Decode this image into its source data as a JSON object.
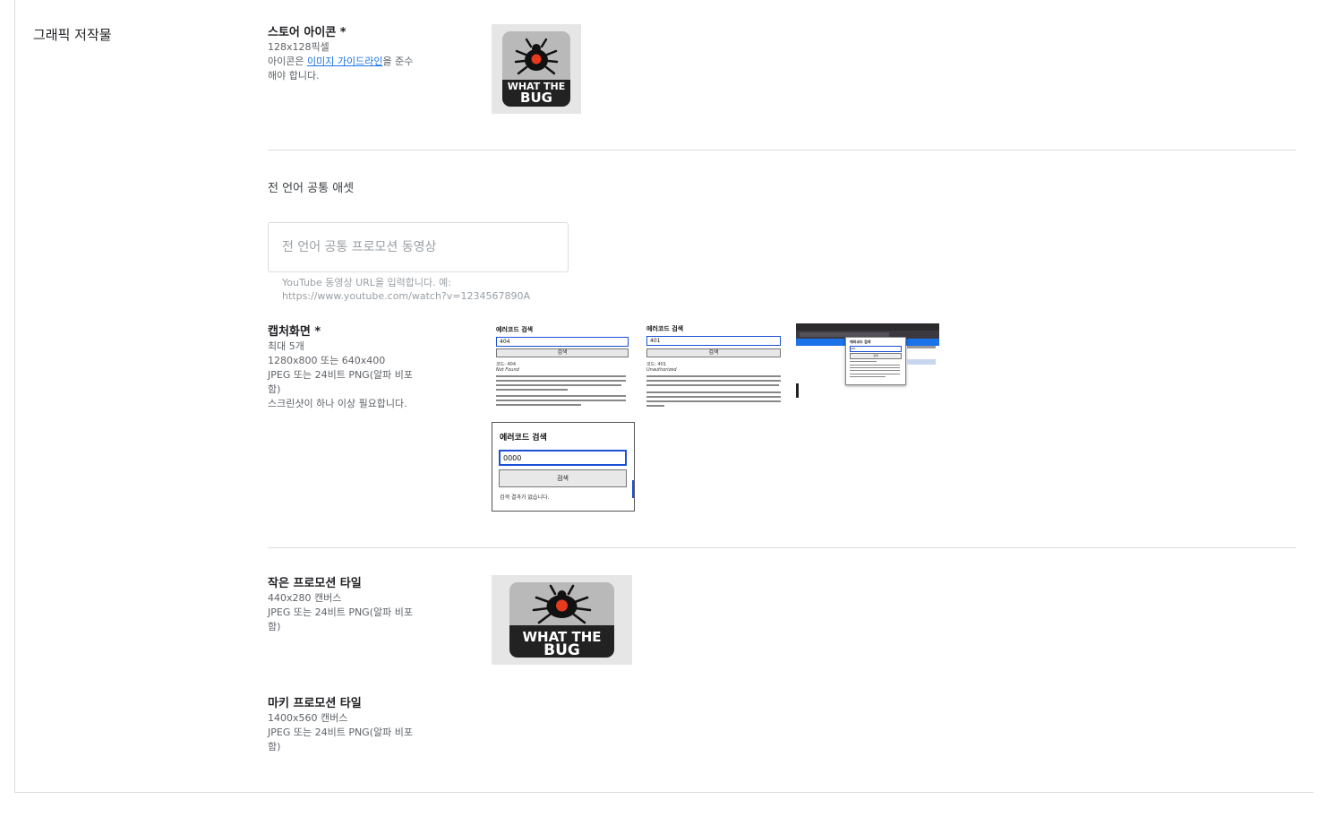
{
  "section": {
    "title": "그래픽 저작물"
  },
  "store_icon": {
    "title": "스토어 아이콘 *",
    "size": "128x128픽셀",
    "guide_prefix": "아이콘은 ",
    "guide_link": "이미지 가이드라인",
    "guide_suffix": "을 준수",
    "guide_line2": "해야 합니다.",
    "logo": {
      "line1": "WHAT THE",
      "line2": "BUG"
    }
  },
  "common_assets": {
    "heading": "전 언어 공통 애셋",
    "video_placeholder": "전 언어 공통 프로모션 동영상",
    "video_value": "",
    "hint_line1": "YouTube 동영상 URL을 입력합니다. 예:",
    "hint_line2": "https://www.youtube.com/watch?v=1234567890A"
  },
  "screenshots": {
    "title": "캡처화면 *",
    "max": "최대 5개",
    "size": "1280x800 또는 640x400",
    "format_line1": "JPEG 또는 24비트 PNG(알파 비포",
    "format_line2": "함)",
    "requirement": "스크린샷이 하나 이상 필요합니다.",
    "items": [
      {
        "title": "에러코드 검색",
        "input": "404",
        "button": "검색",
        "code": "코드: 404",
        "status": "Not Found"
      },
      {
        "title": "에러코드 검색",
        "input": "401",
        "button": "검색",
        "code": "코드: 401",
        "status": "Unauthorized"
      },
      {
        "title": "에러코드 검색",
        "input": "401",
        "button": "검색"
      },
      {
        "title": "에러코드 검색",
        "input": "0000",
        "button": "검색",
        "result": "검색 결과가 없습니다."
      }
    ]
  },
  "small_tile": {
    "title": "작은 프로모션 타일",
    "size": "440x280 캔버스",
    "format_line1": "JPEG 또는 24비트 PNG(알파 비포",
    "format_line2": "함)",
    "logo": {
      "line1": "WHAT THE",
      "line2": "BUG"
    }
  },
  "marquee_tile": {
    "title": "마키 프로모션 타일",
    "size": "1400x560 캔버스",
    "format_line1": "JPEG 또는 24비트 PNG(알파 비포",
    "format_line2": "함)"
  }
}
